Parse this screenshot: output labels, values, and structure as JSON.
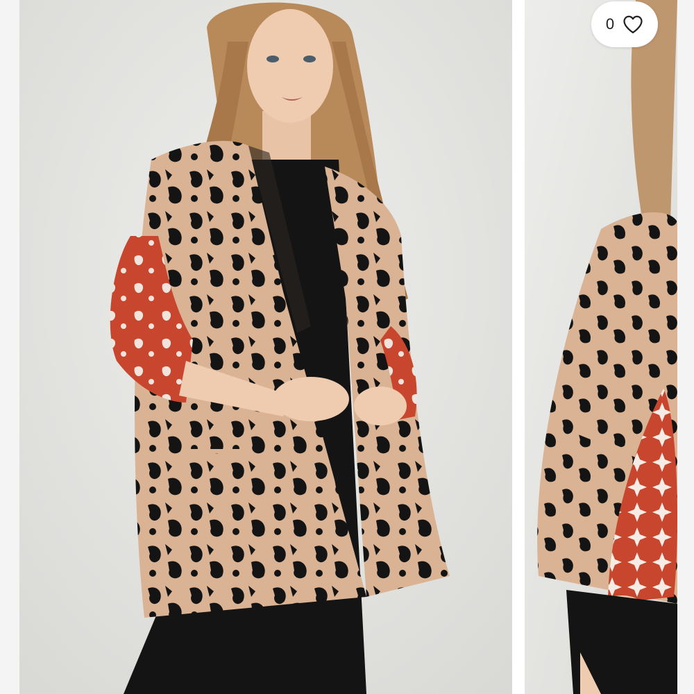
{
  "listing": {
    "like_count": "0",
    "like_icon": "heart-outline-icon",
    "photos": [
      {
        "subject": "model-front-view"
      },
      {
        "subject": "model-side-view"
      }
    ]
  },
  "colors": {
    "backdrop": "#e6e6e4",
    "knit_tan": "#d9b393",
    "knit_black": "#141414",
    "sleeve_rust": "#c8462e",
    "hair_blonde": "#b88a5a",
    "pill_bg": "#ffffff",
    "text": "#222222"
  }
}
